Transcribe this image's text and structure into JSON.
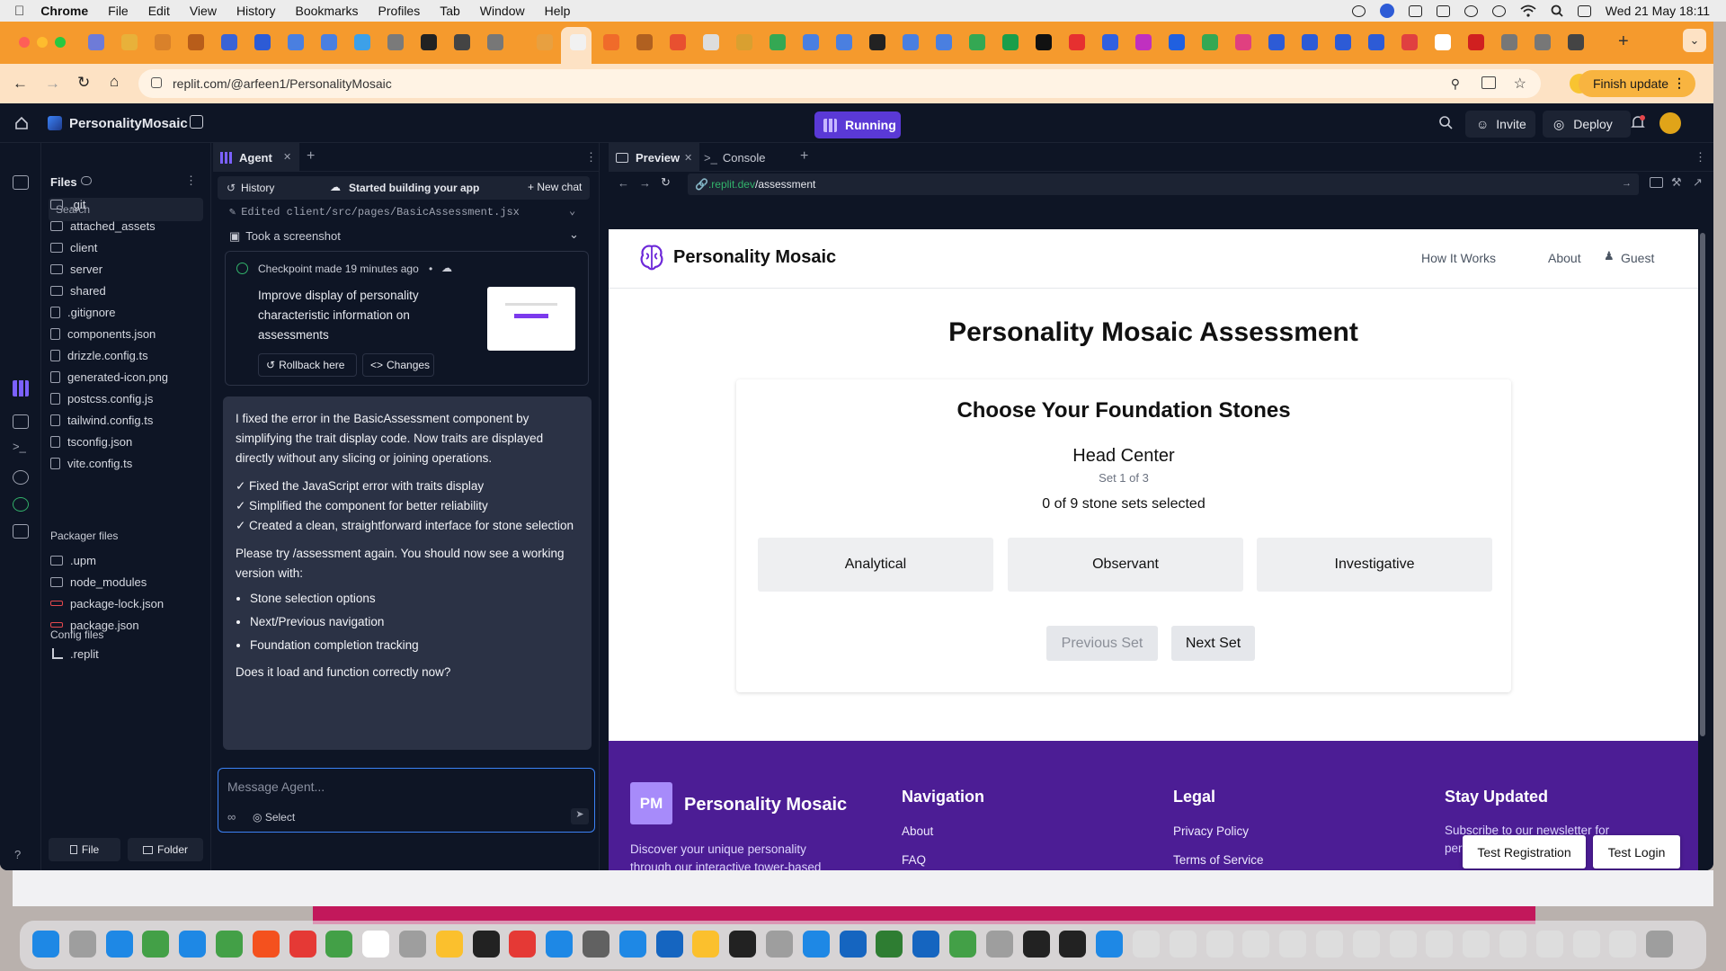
{
  "menubar": {
    "apple": "",
    "items": [
      "Chrome",
      "File",
      "Edit",
      "View",
      "History",
      "Bookmarks",
      "Profiles",
      "Tab",
      "Window",
      "Help"
    ],
    "datetime": "Wed 21 May  18:11"
  },
  "browser": {
    "url": "replit.com/@arfeen1/PersonalityMosaic",
    "finish_update": "Finish update",
    "tab_favicon_colors": [
      "#6e7bd8",
      "#e8b13a",
      "#d9812a",
      "#b85d1a",
      "#3a63d6",
      "#2d5bd6",
      "#4a7fe0",
      "#4a7fe0",
      "#3da0e8",
      "#7a7a7a",
      "#222",
      "#444",
      "#777",
      "#e8a040",
      "#f1f1f1",
      "#f06b2a",
      "#b06020",
      "#e85030",
      "#dddddd",
      "#d9a030",
      "#34a853",
      "#4a7fe0",
      "#4a7fe0",
      "#222",
      "#4a7fe0",
      "#4a7fe0",
      "#34a853",
      "#1a9e4a",
      "#111",
      "#e63030",
      "#3060e0",
      "#c030c0",
      "#2060e0",
      "#34a853",
      "#e04080",
      "#2d5bd6",
      "#2d5bd6",
      "#2d5bd6",
      "#2d5bd6",
      "#e04040",
      "#ffffff",
      "#d02020",
      "#777",
      "#777",
      "#444"
    ]
  },
  "replit": {
    "project": "PersonalityMosaic",
    "run_status": "Running",
    "invite": "Invite",
    "deploy": "Deploy",
    "files": {
      "title": "Files",
      "search_placeholder": "Search",
      "items": [
        ".git",
        "attached_assets",
        "client",
        "server",
        "shared",
        ".gitignore",
        "components.json",
        "drizzle.config.ts",
        "generated-icon.png",
        "postcss.config.js",
        "tailwind.config.ts",
        "tsconfig.json",
        "vite.config.ts"
      ],
      "packager_title": "Packager files",
      "packager_items": [
        ".upm",
        "node_modules",
        "package-lock.json",
        "package.json"
      ],
      "config_title": "Config files",
      "config_items": [
        ".replit"
      ],
      "new_file": "File",
      "new_folder": "Folder"
    },
    "agent": {
      "tab": "Agent",
      "history": "History",
      "status": "Started building your app",
      "new_chat": "New chat",
      "edited_line": "Edited client/src/pages/BasicAssessment.jsx",
      "took_screenshot": "Took a screenshot",
      "checkpoint_label": "Checkpoint made 19 minutes ago",
      "checkpoint_dot": "•",
      "checkpoint_text": "Improve display of personality characteristic information on assessments",
      "rollback": "Rollback here",
      "changes": "Changes",
      "msg_p1": "I fixed the error in the BasicAssessment component by simplifying the trait display code. Now traits are displayed directly without any slicing or joining operations.",
      "checks": [
        "✓ Fixed the JavaScript error with traits display",
        "✓ Simplified the component for better reliability",
        "✓ Created a clean, straightforward interface for stone selection"
      ],
      "msg_p2": "Please try /assessment again. You should now see a working version with:",
      "bullets": [
        "Stone selection options",
        "Next/Previous navigation",
        "Foundation completion tracking"
      ],
      "msg_p3": "Does it load and function correctly now?",
      "input_placeholder": "Message Agent...",
      "select": "Select"
    },
    "preview": {
      "tab_preview": "Preview",
      "tab_console": "Console",
      "url_prefix": ".replit.dev",
      "url_path": "/assessment"
    }
  },
  "site": {
    "brand": "Personality Mosaic",
    "nav": [
      "How It Works",
      "About",
      "Guest"
    ],
    "page_title": "Personality Mosaic Assessment",
    "card_title": "Choose Your Foundation Stones",
    "center": "Head Center",
    "set_label": "Set 1 of 3",
    "selected_count": "0 of 9 stone sets selected",
    "stones": [
      "Analytical",
      "Observant",
      "Investigative"
    ],
    "prev": "Previous Set",
    "next": "Next Set",
    "footer": {
      "logo": "PM",
      "brand": "Personality Mosaic",
      "desc": "Discover your unique personality through our interactive tower-based assessment system.",
      "nav_title": "Navigation",
      "nav_items": [
        "About",
        "FAQ"
      ],
      "legal_title": "Legal",
      "legal_items": [
        "Privacy Policy",
        "Terms of Service"
      ],
      "news_title": "Stay Updated",
      "news_text": "Subscribe to our newsletter for personalized tips."
    },
    "test_registration": "Test Registration",
    "test_login": "Test Login"
  }
}
